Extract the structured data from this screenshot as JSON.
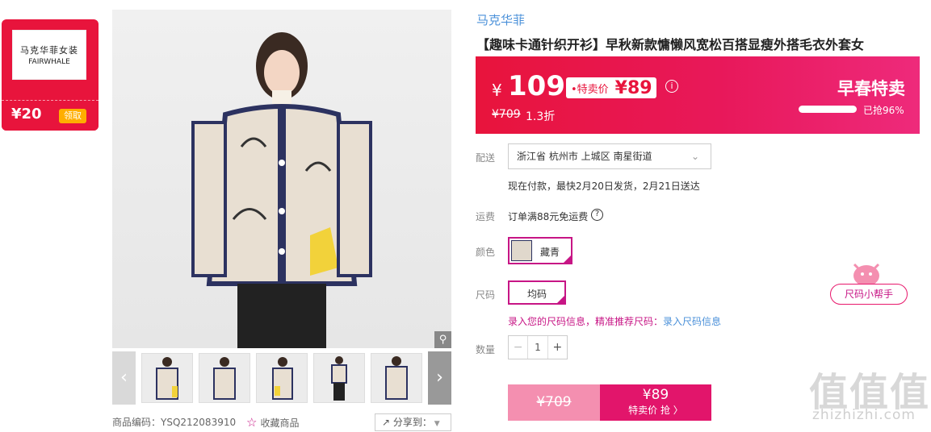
{
  "coupon": {
    "brand_cn": "马克华菲女装",
    "brand_en": "FAIRWHALE",
    "amount": "¥20",
    "get_label": "领取"
  },
  "thumbnails_count": 5,
  "product_code": "商品编码：YSQ212083910",
  "favorite_label": "收藏商品",
  "share_label": "分享到：",
  "brand_link": "马克华菲",
  "title": "【趣味卡通针织开衫】早秋新款慵懒风宽松百搭显瘦外搭毛衣外套女",
  "price": {
    "yen": "¥",
    "big": "109",
    "sale_label": "•特卖价",
    "sale_price": "¥89",
    "original": "¥709",
    "discount": "1.3折",
    "promo_title": "早春特卖",
    "sold_text": "已抢96%",
    "sold_fraction": 0.96
  },
  "delivery": {
    "label": "配送",
    "address": "浙江省 杭州市 上城区 南星街道",
    "note": "现在付款，最快2月20日发货，2月21日送达"
  },
  "shipping": {
    "label": "运费",
    "text": "订单满88元免运费"
  },
  "color": {
    "label": "颜色",
    "value": "藏青"
  },
  "size": {
    "label": "尺码",
    "value": "均码",
    "helper": "尺码小帮手",
    "info_left": "录入您的尺码信息，精准推荐尺码：",
    "info_link": "录入尺码信息"
  },
  "quantity": {
    "label": "数量",
    "minus": "−",
    "value": "1",
    "plus": "+"
  },
  "buy": {
    "original": "¥709",
    "price": "¥89",
    "action": "特卖价 抢 〉"
  },
  "watermark": {
    "logo": "值值值",
    "url": "zhizhizhi.com"
  },
  "colors": {
    "accent": "#e8143c",
    "pink": "#e2156b",
    "link": "#4a90d9"
  }
}
